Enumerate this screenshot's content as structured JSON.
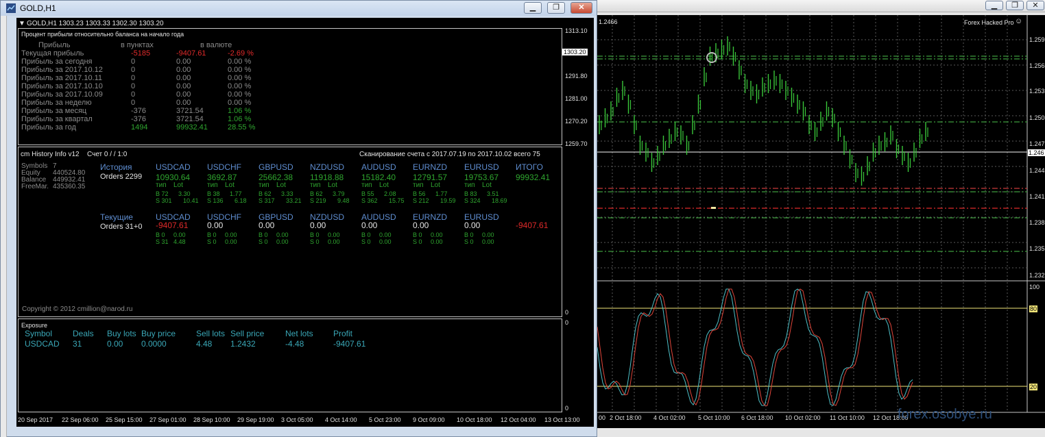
{
  "left_window": {
    "title": "GOLD,H1",
    "ohlc": "GOLD,H1  1303.23 1303.33 1302.30 1303.20",
    "buttons": {
      "minimize": "▁",
      "restore": "❐",
      "close": "✕"
    }
  },
  "profit_panel": {
    "subtitle": "Процент прибыли относительно баланса на начало года",
    "headers": {
      "profit": "Прибыль",
      "points": "в пунктах",
      "currency": "в валюте"
    },
    "rows": [
      {
        "label": "Текущая прибыль",
        "points": "-5185",
        "currency": "-9407.61",
        "pct": "-2.69 %"
      },
      {
        "label": "Прибыль за сегодня",
        "points": "0",
        "currency": "0.00",
        "pct": "0.00 %"
      },
      {
        "label": "Прибыль за 2017.10.12",
        "points": "0",
        "currency": "0.00",
        "pct": "0.00 %"
      },
      {
        "label": "Прибыль за 2017.10.11",
        "points": "0",
        "currency": "0.00",
        "pct": "0.00 %"
      },
      {
        "label": "Прибыль за 2017.10.10",
        "points": "0",
        "currency": "0.00",
        "pct": "0.00 %"
      },
      {
        "label": "Прибыль за 2017.10.09",
        "points": "0",
        "currency": "0.00",
        "pct": "0.00 %"
      },
      {
        "label": "Прибыль за неделю",
        "points": "0",
        "currency": "0.00",
        "pct": "0.00 %"
      },
      {
        "label": "Прибыль за месяц",
        "points": "-376",
        "currency": "3721.54",
        "pct": "1.06 %"
      },
      {
        "label": "Прибыль за квартал",
        "points": "-376",
        "currency": "3721.54",
        "pct": "1.06 %"
      },
      {
        "label": "Прибыль за год",
        "points": "1494",
        "currency": "99932.41",
        "pct": "28.55 %"
      }
    ]
  },
  "price_axis_left": [
    "1313.10",
    "1303.20",
    "1291.80",
    "1281.00",
    "1270.20",
    "1259.70"
  ],
  "history_panel": {
    "title": "cm History Info v12",
    "account": "Счет 0 /  / 1:0",
    "scan": "Сканирование счета с 2017.07.19 по 2017.10.02 всего 75",
    "stats": [
      {
        "k": "Symbols",
        "v": "7"
      },
      {
        "k": "Equity",
        "v": "440524.80"
      },
      {
        "k": "Balance",
        "v": "449932.41"
      },
      {
        "k": "FreeMar.",
        "v": "435360.35"
      }
    ],
    "history_label": "История",
    "orders_history": "Orders 2299",
    "current_label": "Текущие",
    "orders_current": "Orders 31+0",
    "type_label": "тип",
    "lot_label": "Lot",
    "total_label": "ИТОГО",
    "total_history": "99932.41",
    "total_current": "-9407.61",
    "symbols": [
      {
        "name": "USDCAD",
        "hist": "10930.64",
        "b": "B 72",
        "b_lot": "3.30",
        "s": "S 301",
        "s_lot": "10.41",
        "cur": "-9407.61",
        "cb": "B 0",
        "cb_lot": "0.00",
        "cs": "S 31",
        "cs_lot": "4.48"
      },
      {
        "name": "USDCHF",
        "hist": "3692.87",
        "b": "B 38",
        "b_lot": "1.77",
        "s": "S 136",
        "s_lot": "6.18",
        "cur": "0.00",
        "cb": "B 0",
        "cb_lot": "0.00",
        "cs": "S 0",
        "cs_lot": "0.00"
      },
      {
        "name": "GBPUSD",
        "hist": "25662.38",
        "b": "B 62",
        "b_lot": "3.33",
        "s": "S 317",
        "s_lot": "33.21",
        "cur": "0.00",
        "cb": "B 0",
        "cb_lot": "0.00",
        "cs": "S 0",
        "cs_lot": "0.00"
      },
      {
        "name": "NZDUSD",
        "hist": "11918.88",
        "b": "B 62",
        "b_lot": "3.79",
        "s": "S 219",
        "s_lot": "9.48",
        "cur": "0.00",
        "cb": "B 0",
        "cb_lot": "0.00",
        "cs": "S 0",
        "cs_lot": "0.00"
      },
      {
        "name": "AUDUSD",
        "hist": "15182.40",
        "b": "B 55",
        "b_lot": "2.08",
        "s": "S 362",
        "s_lot": "15.75",
        "cur": "0.00",
        "cb": "B 0",
        "cb_lot": "0.00",
        "cs": "S 0",
        "cs_lot": "0.00"
      },
      {
        "name": "EURNZD",
        "hist": "12791.57",
        "b": "B 56",
        "b_lot": "1.77",
        "s": "S 212",
        "s_lot": "19.59",
        "cur": "0.00",
        "cb": "B 0",
        "cb_lot": "0.00",
        "cs": "S 0",
        "cs_lot": "0.00"
      },
      {
        "name": "EURUSD",
        "hist": "19753.67",
        "b": "B 83",
        "b_lot": "3.51",
        "s": "S 324",
        "s_lot": "18.69",
        "cur": "0.00",
        "cb": "B 0",
        "cb_lot": "0.00",
        "cs": "S 0",
        "cs_lot": "0.00"
      }
    ],
    "copyright": "Copyright © 2012 cmillion@narod.ru"
  },
  "exposure_panel": {
    "title": "Exposure",
    "headers": [
      "Symbol",
      "Deals",
      "Buy lots",
      "Buy price",
      "Sell lots",
      "Sell price",
      "Net lots",
      "Profit"
    ],
    "row": [
      "USDCAD",
      "31",
      "0.00",
      "0.0000",
      "4.48",
      "1.2432",
      "-4.48",
      "-9407.61"
    ]
  },
  "sub_axis": {
    "zero_a": "0",
    "zero_b": "0",
    "zero_c": "0"
  },
  "time_axis_left": [
    "20 Sep 2017",
    "22 Sep 06:00",
    "25 Sep 15:00",
    "27 Sep 01:00",
    "28 Sep 10:00",
    "29 Sep 19:00",
    "3 Oct 05:00",
    "4 Oct 14:00",
    "5 Oct 23:00",
    "9 Oct 09:00",
    "10 Oct 18:00",
    "12 Oct 04:00",
    "13 Oct 13:00"
  ],
  "right_window": {
    "price_tag": "1.2466",
    "indicator": "Forex Hacked Pro",
    "price_axis": [
      "1.259",
      "1.256",
      "1.253",
      "1.250",
      "1.247",
      "1.246",
      "1.244",
      "1.241",
      "1.238",
      "1.235",
      "1.232"
    ],
    "stoch_levels": [
      "100",
      "80",
      "20"
    ],
    "time_axis": [
      "00",
      "2 Oct 18:00",
      "4 Oct 02:00",
      "5 Oct 10:00",
      "6 Oct 18:00",
      "10 Oct 02:00",
      "11 Oct 10:00",
      "12 Oct 18:00"
    ],
    "watermark": "forex.osobye.ru"
  },
  "colors": {
    "bg": "#000000",
    "profit_neg": "#e02a2a",
    "profit_pos": "#2fa62f",
    "symbol_blue": "#5f8ed1",
    "candle_green": "#39c639",
    "stoch_red": "#e0453a",
    "stoch_cyan": "#4ec0c8"
  }
}
